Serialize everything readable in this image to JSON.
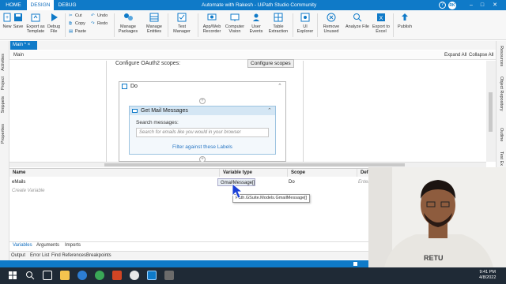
{
  "app": {
    "tabs": [
      "HOME",
      "DESIGN",
      "DEBUG"
    ],
    "active_tab": "DESIGN",
    "window_title": "Automate with Rakesh - UiPath Studio Community",
    "user_initials": "RK",
    "help": "?"
  },
  "ribbon": {
    "new": "New",
    "save": "Save",
    "export_template": "Export as Template",
    "debug_file": "Debug File",
    "cut": "Cut",
    "copy": "Copy",
    "paste": "Paste",
    "undo": "Undo",
    "redo": "Redo",
    "manage_packages": "Manage Packages",
    "manage_entities": "Manage Entities",
    "test_manager": "Test Manager",
    "app_web_recorder": "App/Web Recorder",
    "computer_vision": "Computer Vision",
    "user_events": "User Events",
    "table_extraction": "Table Extraction",
    "ui_explorer": "UI Explorer",
    "remove_unused": "Remove Unused",
    "analyze_file": "Analyze File",
    "export_excel": "Export to Excel",
    "publish": "Publish"
  },
  "document": {
    "tab_label": "Main *",
    "breadcrumb": "Main",
    "expand_all": "Expand All",
    "collapse_all": "Collapse All"
  },
  "left_rail": [
    "Activities",
    "Project",
    "Snippets",
    "Properties"
  ],
  "right_rail": [
    "Resources",
    "Object Repository",
    "Outline",
    "Test Ex"
  ],
  "designer": {
    "oauth_label": "Configure OAuth2 scopes:",
    "oauth_button": "Configure scopes",
    "do_title": "Do",
    "activity_title": "Get Mail Messages",
    "search_label": "Search messages:",
    "search_placeholder": "Search for emails like you would in your browser",
    "filter_link": "Filter against these Labels"
  },
  "variables": {
    "headers": [
      "Name",
      "Variable type",
      "Scope",
      "Defau"
    ],
    "rows": [
      {
        "name": "eMails",
        "type": "GmailMessage[]",
        "scope": "Do",
        "default": "Enter"
      }
    ],
    "create_label": "Create Variable",
    "tooltip": "Path.GSuite.Models.GmailMessage[]"
  },
  "bottom_tabs": [
    "Variables",
    "Arguments",
    "Imports"
  ],
  "output_tabs": [
    "Output",
    "Error List",
    "Find References",
    "Breakpoints"
  ],
  "taskbar": {
    "time": "9:41 PM",
    "date": "4/8/2022"
  },
  "colors": {
    "accent": "#0f7ac8",
    "taskbar": "#1f2a36",
    "link": "#2b78c5"
  }
}
